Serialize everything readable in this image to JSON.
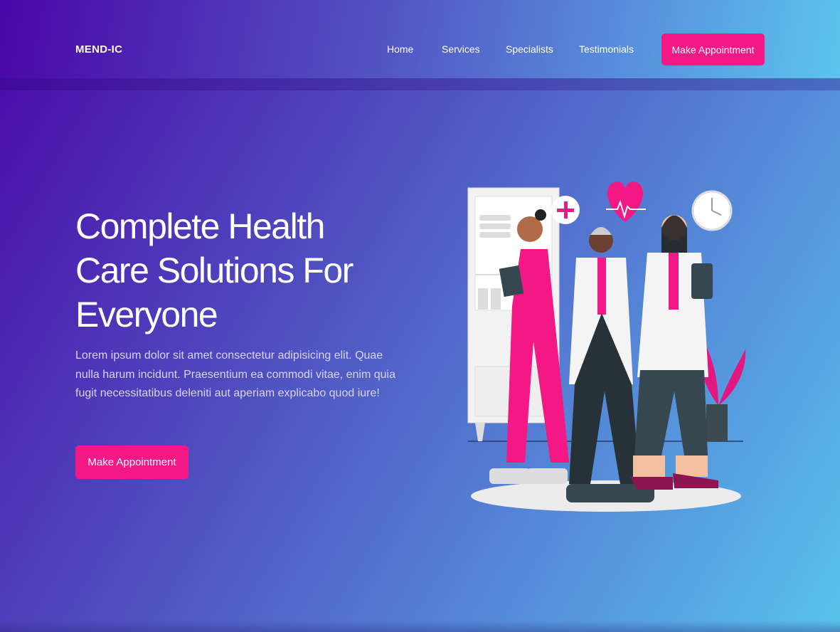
{
  "header": {
    "logo": "MEND-IC",
    "nav": [
      {
        "label": "Home"
      },
      {
        "label": "Services"
      },
      {
        "label": "Specialists"
      },
      {
        "label": "Testimonials"
      }
    ],
    "cta_label": "Make Appointment"
  },
  "hero": {
    "title_lines": [
      "Complete Health",
      "Care Solutions For",
      "Everyone"
    ],
    "description": "Lorem ipsum dolor sit amet consectetur adipisicing elit. Quae nulla harum incidunt. Praesentium ea commodi vitae, enim quia fugit necessitatibus deleniti aut aperiam explicabo quod iure!",
    "cta_label": "Make Appointment",
    "illustration": "medical-team-illustration"
  },
  "colors": {
    "accent": "#f31885",
    "gradient_start": "#4a06a8",
    "gradient_end": "#58c2ec"
  }
}
